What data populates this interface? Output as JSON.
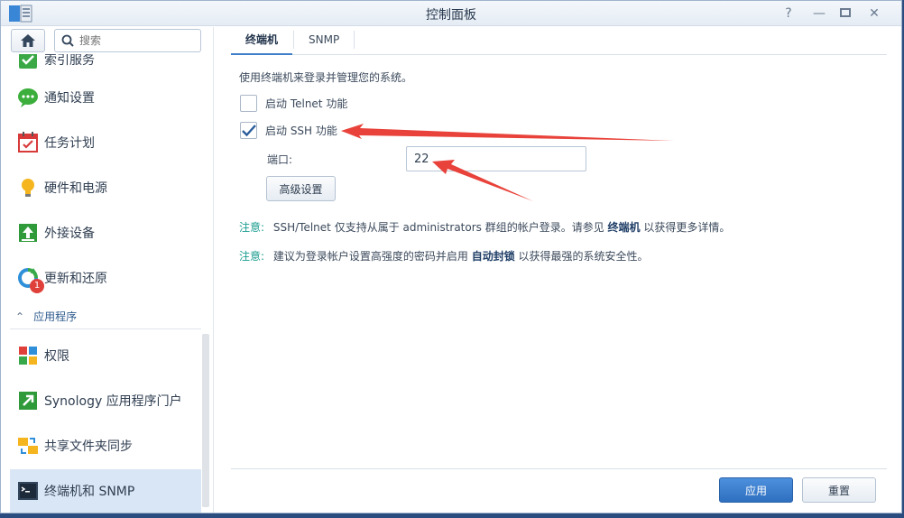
{
  "window": {
    "title": "控制面板",
    "icons": [
      "help-icon",
      "minimize-icon",
      "maximize-icon",
      "close-icon"
    ]
  },
  "sidebar": {
    "search_placeholder": "搜索",
    "partial_item_label": "索引服务",
    "items": [
      {
        "label": "通知设置",
        "icon": "notification-icon"
      },
      {
        "label": "任务计划",
        "icon": "calendar-icon"
      },
      {
        "label": "硬件和电源",
        "icon": "lightbulb-icon"
      },
      {
        "label": "外接设备",
        "icon": "external-device-icon"
      },
      {
        "label": "更新和还原",
        "icon": "update-icon",
        "badge": "1"
      }
    ],
    "section_label": "应用程序",
    "app_items": [
      {
        "label": "权限",
        "icon": "privileges-icon"
      },
      {
        "label": "Synology 应用程序门户",
        "icon": "app-portal-icon"
      },
      {
        "label": "共享文件夹同步",
        "icon": "shared-folder-sync-icon"
      },
      {
        "label": "终端机和 SNMP",
        "icon": "terminal-icon",
        "active": true
      }
    ]
  },
  "tabs": [
    {
      "label": "终端机",
      "active": true
    },
    {
      "label": "SNMP",
      "active": false
    }
  ],
  "terminal": {
    "description": "使用终端机来登录并管理您的系统。",
    "telnet_label": "启动 Telnet 功能",
    "telnet_checked": false,
    "ssh_label": "启动 SSH 功能",
    "ssh_checked": true,
    "port_label": "端口:",
    "port_value": "22",
    "advanced_button": "高级设置",
    "notes": [
      {
        "label": "注意:",
        "text_before": "SSH/Telnet 仅支持从属于 administrators 群组的帐户登录。请参见 ",
        "link": "终端机",
        "text_after": " 以获得更多详情。"
      },
      {
        "label": "注意:",
        "text_before": "建议为登录帐户设置高强度的密码并启用 ",
        "link": "自动封锁",
        "text_after": " 以获得最强的系统安全性。"
      }
    ]
  },
  "footer": {
    "apply_label": "应用",
    "reset_label": "重置"
  },
  "colors": {
    "accent": "#3f7ec8",
    "note": "#1a9c8f",
    "annotation_arrow": "#e8423a",
    "active_nav": "#d9e6f5"
  }
}
